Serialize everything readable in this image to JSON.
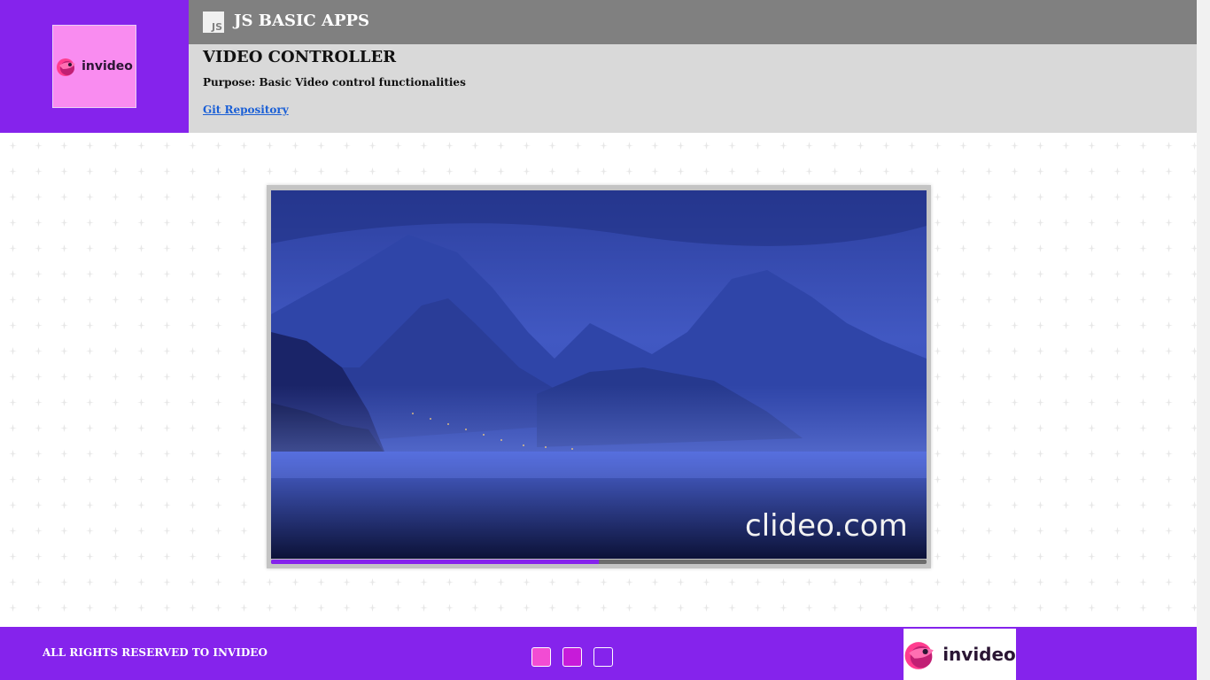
{
  "header": {
    "logo_word": "invideo",
    "app_badge": "JS",
    "app_title": "JS BASIC APPS"
  },
  "info": {
    "title": "VIDEO CONTROLLER",
    "purpose": "Purpose: Basic Video control functionalities",
    "repo_link": "Git Repository"
  },
  "player": {
    "watermark": "clideo.com",
    "progress_fraction": 0.5
  },
  "footer": {
    "rights": "ALL RIGHTS RESERVED TO INVIDEO",
    "logo_word": "invideo",
    "colors": [
      "#f24cd3",
      "#c71bd9",
      "#8523ec"
    ]
  },
  "colors": {
    "brand": "#8523ec",
    "brand_tile": "#f98cf0",
    "topbar": "#808080",
    "info_bg": "#d9d9d9",
    "link": "#1a5fd6"
  }
}
